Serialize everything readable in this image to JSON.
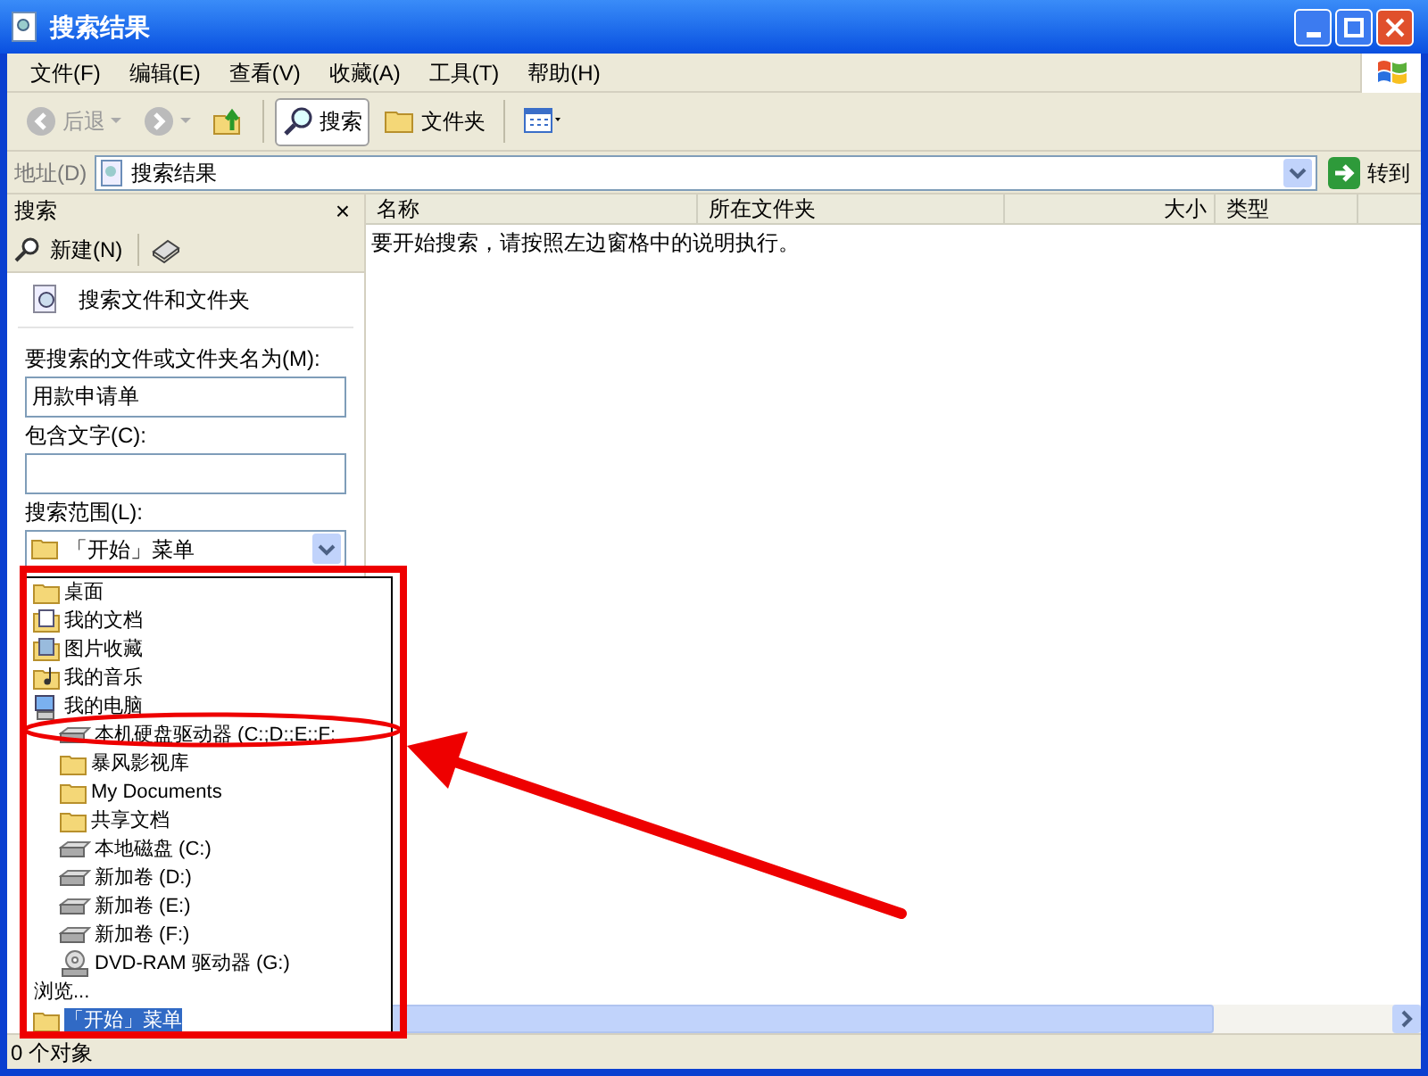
{
  "window": {
    "title": "搜索结果"
  },
  "menu_bar": [
    "文件(F)",
    "编辑(E)",
    "查看(V)",
    "收藏(A)",
    "工具(T)",
    "帮助(H)"
  ],
  "toolbar": [
    {
      "kind": "back",
      "label": "后退",
      "disabled": true
    },
    {
      "kind": "forward",
      "disabled": true
    },
    {
      "kind": "up"
    },
    {
      "kind": "search",
      "label": "搜索",
      "selected": true
    },
    {
      "kind": "folders",
      "label": "文件夹",
      "selected": false
    },
    {
      "kind": "views"
    }
  ],
  "address_bar": {
    "label": "地址(D)",
    "value": "搜索结果",
    "go": "转到"
  },
  "search_pane": {
    "title": "搜索",
    "close": "×",
    "new": "新建(N)",
    "heading": "搜索文件和文件夹",
    "name_label": "要搜索的文件或文件夹名为(M):",
    "name_value": "用款申请单",
    "text_label": "包含文字(C):",
    "scope_label": "搜索范围(L):",
    "scope_value": "「开始」菜单",
    "scope_list": [
      {
        "kind": "folder",
        "label": "桌面",
        "selected": false
      },
      {
        "kind": "documents",
        "label": "我的文档",
        "selected": false
      },
      {
        "kind": "pictures",
        "label": "图片收藏",
        "selected": false
      },
      {
        "kind": "music",
        "label": "我的音乐",
        "selected": false
      },
      {
        "kind": "computer",
        "label": "我的电脑",
        "selected": false,
        "children": [
          {
            "kind": "drive",
            "label": "本机硬盘驱动器 (C:;D:;E:;F:",
            "selected": false
          },
          {
            "kind": "folder",
            "label": "暴风影视库",
            "selected": false
          },
          {
            "kind": "folder",
            "label": "My Documents",
            "selected": false
          },
          {
            "kind": "folder",
            "label": "共享文档",
            "selected": false
          },
          {
            "kind": "drive",
            "label": "本地磁盘 (C:)",
            "selected": false
          },
          {
            "kind": "drive",
            "label": "新加卷 (D:)",
            "selected": false
          },
          {
            "kind": "drive",
            "label": "新加卷 (E:)",
            "selected": false
          },
          {
            "kind": "drive",
            "label": "新加卷 (F:)",
            "selected": false
          },
          {
            "kind": "cdrom",
            "label": "DVD-RAM 驱动器 (G:)",
            "selected": false
          }
        ]
      },
      {
        "kind": "plain",
        "label": "浏览...",
        "selected": false
      },
      {
        "kind": "folder",
        "label": "「开始」菜单",
        "selected": true
      }
    ]
  },
  "columns": [
    "名称",
    "所在文件夹",
    "大小",
    "类型"
  ],
  "message": "要开始搜索，请按照左边窗格中的说明执行。",
  "status_bar": "0 个对象"
}
